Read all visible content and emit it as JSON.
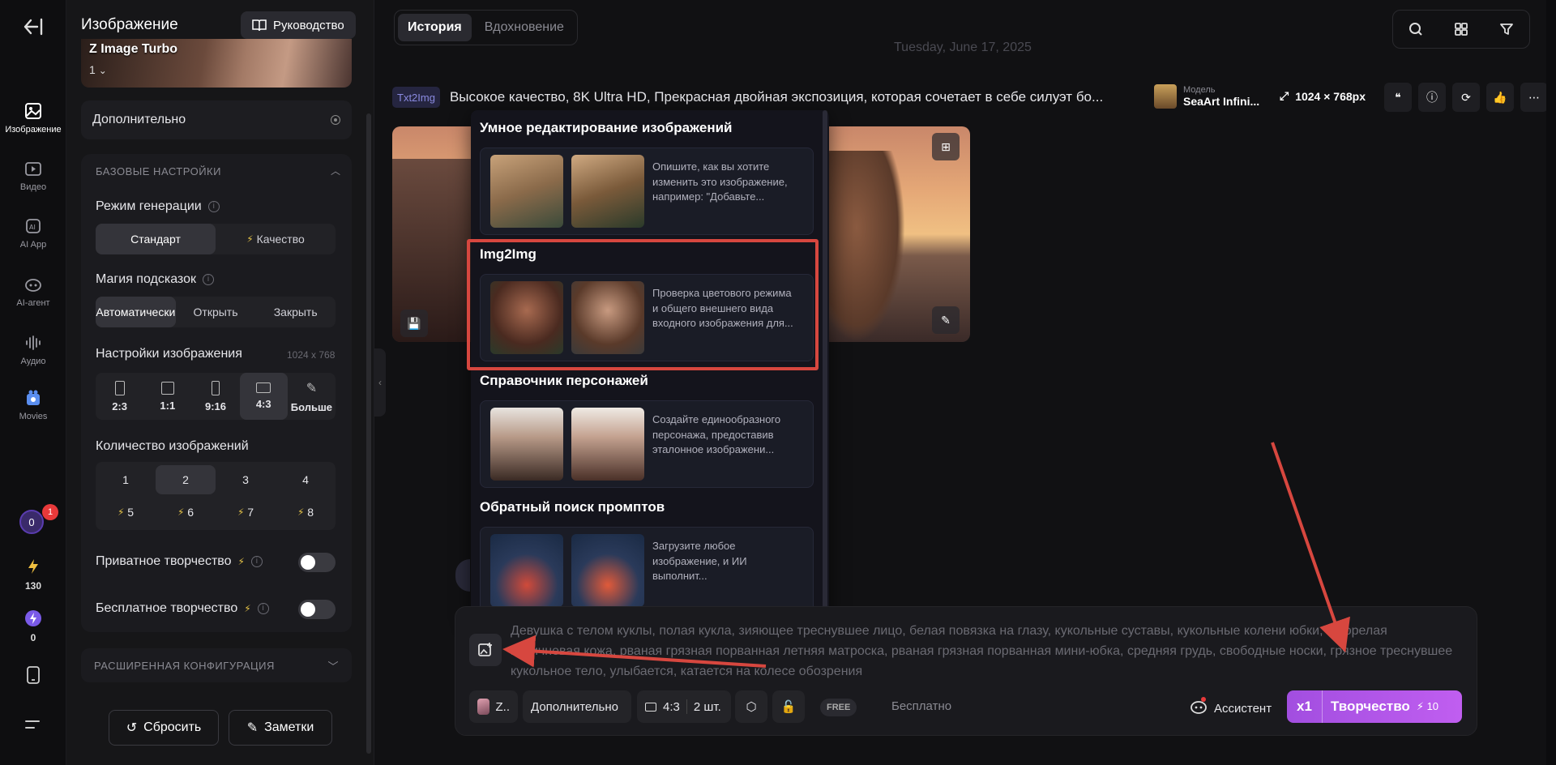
{
  "rail": {
    "items": [
      {
        "label": "Изображение",
        "icon": "image-icon"
      },
      {
        "label": "Видео",
        "icon": "video-icon"
      },
      {
        "label": "AI App",
        "icon": "ai-app-icon"
      },
      {
        "label": "AI-агент",
        "icon": "agent-icon"
      },
      {
        "label": "Аудио",
        "icon": "audio-icon"
      },
      {
        "label": "Movies",
        "icon": "movies-icon"
      }
    ],
    "credits": "0",
    "notifications": "1",
    "energy": "130",
    "power": "0"
  },
  "panel": {
    "title": "Изображение",
    "guide_label": "Руководство",
    "model_name": "Z Image Turbo",
    "model_version": "1",
    "advanced_label": "Дополнительно",
    "base_section": "БАЗОВЫЕ НАСТРОЙКИ",
    "gen_mode_label": "Режим генерации",
    "gen_modes": [
      "Стандарт",
      "Качество"
    ],
    "magic_label": "Магия подсказок",
    "magic_modes": [
      "Автоматически",
      "Открыть",
      "Закрыть"
    ],
    "image_settings_label": "Настройки изображения",
    "image_size": "1024 x 768",
    "ratios": [
      "2:3",
      "1:1",
      "9:16",
      "4:3",
      "Больше"
    ],
    "count_label": "Количество изображений",
    "counts": [
      "1",
      "2",
      "3",
      "4",
      "5",
      "6",
      "7",
      "8"
    ],
    "private_label": "Приватное творчество",
    "free_label": "Бесплатное творчество",
    "ext_section": "РАСШИРЕННАЯ КОНФИГУРАЦИЯ",
    "reset_label": "Сбросить",
    "notes_label": "Заметки"
  },
  "main": {
    "tabs": [
      "История",
      "Вдохновение"
    ],
    "date": "Tuesday, June 17, 2025",
    "record": {
      "tag": "Txt2Img",
      "prompt": "Высокое качество, 8K Ultra HD, Прекрасная двойная экспозиция, которая сочетает в себе силуэт бо...",
      "model_caption": "Модель",
      "model_name": "SeaArt Infini...",
      "resolution": "1024 × 768px"
    }
  },
  "dropdown": {
    "sections": [
      {
        "title": "Умное редактирование изображений",
        "desc": "Опишите, как вы хотите изменить это изображение, например: \"Добавьте..."
      },
      {
        "title": "Img2Img",
        "desc": "Проверка цветового режима и общего внешнего вида входного изображения для..."
      },
      {
        "title": "Справочник персонажей",
        "desc": "Создайте единообразного персонажа, предоставив эталонное изображени..."
      },
      {
        "title": "Обратный поиск промптов",
        "desc": "Загрузите любое изображение, и ИИ выполнит..."
      }
    ]
  },
  "composer": {
    "prompt": "Девушка с телом куклы, полая кукла, зияющее треснувшее лицо, белая повязка на глазу, кукольные суставы, кукольные колени юбки, загорелая коричневая кожа, рваная грязная порванная летняя матроска, рваная грязная порванная мини-юбка, средняя грудь, свободные носки, грязное треснувшее кукольное тело, улыбается, катается на колесе обозрения",
    "model_short": "Z..",
    "advanced": "Дополнительно",
    "ratio": "4:3",
    "count": "2 шт.",
    "free_tag": "FREE",
    "free_label": "Бесплатно",
    "assistant": "Ассистент",
    "multiplier": "x1",
    "create_label": "Творчество",
    "create_cost": "10"
  },
  "colors": {
    "accent": "#b055e8",
    "highlight": "#d7473f",
    "annotation_arrow": "#d7473f"
  }
}
